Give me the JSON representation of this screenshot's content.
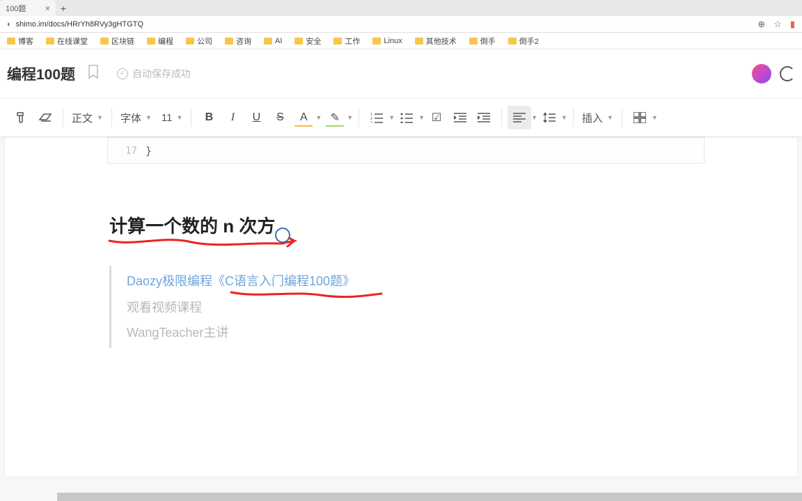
{
  "browser": {
    "tab_title": "100题",
    "url": "shimo.im/docs/HRrYh8RVy3gHTGTQ",
    "bookmarks": [
      "博客",
      "在线课堂",
      "区块链",
      "编程",
      "公司",
      "咨询",
      "AI",
      "安全",
      "工作",
      "Linux",
      "其他技术",
      "倒手",
      "倒手2"
    ]
  },
  "doc": {
    "title": "编程100题",
    "autosave": "自动保存成功"
  },
  "toolbar": {
    "style_label": "正文",
    "font_label": "字体",
    "size_label": "11",
    "insert_label": "插入",
    "icons": {
      "paint": "paint-format-icon",
      "clear": "clear-format-icon",
      "bold": "B",
      "italic": "I",
      "underline": "U",
      "strike": "S",
      "textcolor": "A",
      "highlight": "✎",
      "ol": "ordered-list-icon",
      "ul": "unordered-list-icon",
      "task": "☑",
      "indent_dec": "indent-decrease-icon",
      "indent_inc": "indent-increase-icon",
      "align": "align-icon",
      "lineheight": "line-height-icon",
      "layout": "layout-icon"
    }
  },
  "code": {
    "line_no": "17",
    "line_text": "}"
  },
  "content": {
    "heading": "计算一个数的 n 次方",
    "quote_line1": "Daozy极限编程《C语言入门编程100题》",
    "quote_line2": "观看视频课程",
    "quote_line3": "WangTeacher主讲"
  }
}
